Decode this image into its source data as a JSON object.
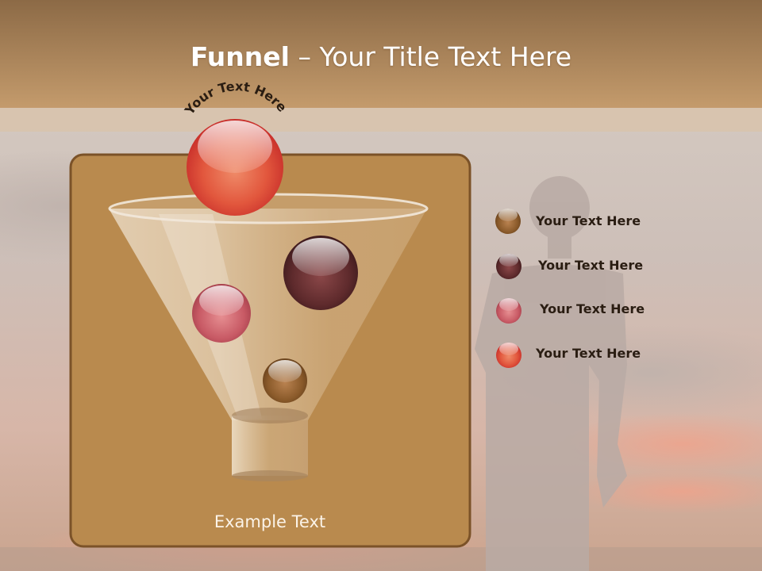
{
  "slide": {
    "title_bold": "Funnel",
    "title_rest": " – Your Title Text Here",
    "arc_text": "Your Text Here",
    "example_text": "Example Text"
  },
  "legend": [
    {
      "label": "Your  Text Here",
      "color": "#8a5a2a"
    },
    {
      "label": "Your  Text Here",
      "color": "#5a2226"
    },
    {
      "label": "Your  Text Here",
      "color": "#c4606a"
    },
    {
      "label": "Your  Text Here",
      "color": "#d8463a"
    }
  ],
  "colors": {
    "header_band": "#a97b4e",
    "panel": "#b98a4e",
    "panel_border": "#7b5228",
    "top_ball": "#e04a3a"
  }
}
